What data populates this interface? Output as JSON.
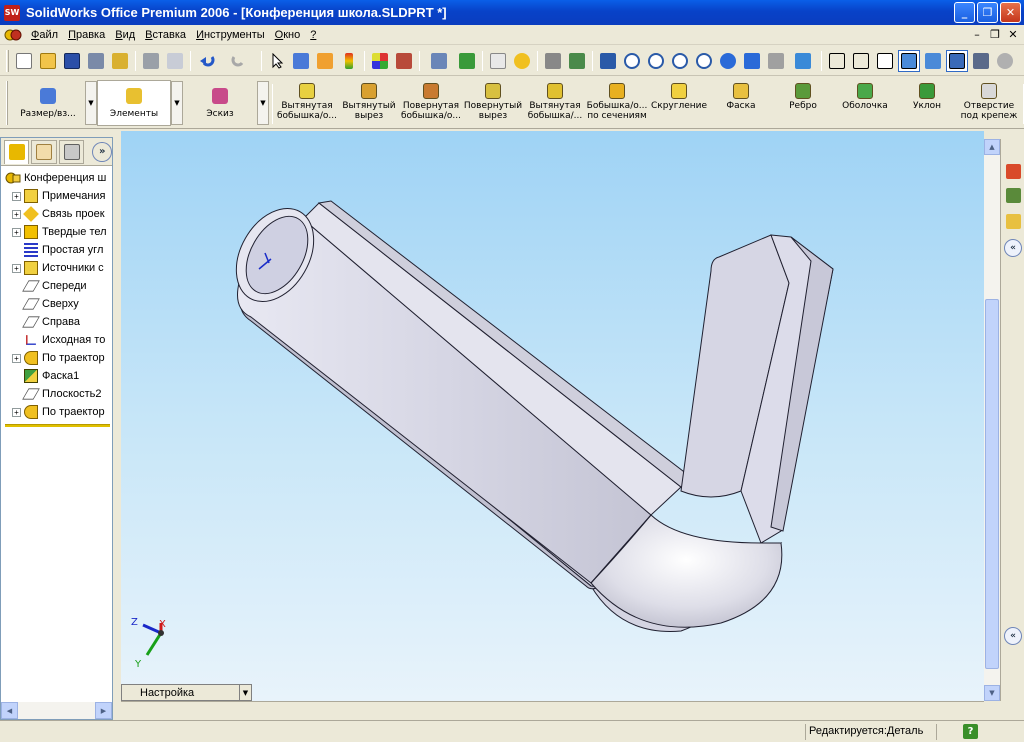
{
  "window": {
    "title": "SolidWorks Office Premium 2006 - [Конференция школа.SLDPRT *]",
    "logo_text": "SW"
  },
  "menu": {
    "items": [
      {
        "u": "Ф",
        "rest": "айл"
      },
      {
        "u": "П",
        "rest": "равка"
      },
      {
        "u": "В",
        "rest": "ид"
      },
      {
        "u": "В",
        "rest": "ставка"
      },
      {
        "u": "И",
        "rest": "нструменты"
      },
      {
        "u": "О",
        "rest": "кно"
      },
      {
        "u": "?",
        "rest": ""
      }
    ]
  },
  "command_manager": {
    "tabs": [
      {
        "label": "Размер/вз...",
        "icon": "dimension-icon"
      },
      {
        "label": "Элементы",
        "icon": "features-icon",
        "active": true
      },
      {
        "label": "Эскиз",
        "icon": "sketch-icon"
      }
    ],
    "commands": [
      {
        "line1": "Вытянутая",
        "line2": "бобышка/о...",
        "icon": "extruded-boss-icon"
      },
      {
        "line1": "Вытянутый",
        "line2": "вырез",
        "icon": "extruded-cut-icon"
      },
      {
        "line1": "Повернутая",
        "line2": "бобышка/о...",
        "icon": "revolved-boss-icon"
      },
      {
        "line1": "Повернутый",
        "line2": "вырез",
        "icon": "revolved-cut-icon"
      },
      {
        "line1": "Вытянутая",
        "line2": "бобышка/...",
        "icon": "swept-boss-icon"
      },
      {
        "line1": "Бобышка/о...",
        "line2": "по сечениям",
        "icon": "loft-icon"
      },
      {
        "line1": "Скругление",
        "line2": "",
        "icon": "fillet-icon"
      },
      {
        "line1": "Фаска",
        "line2": "",
        "icon": "chamfer-icon"
      },
      {
        "line1": "Ребро",
        "line2": "",
        "icon": "rib-icon"
      },
      {
        "line1": "Оболочка",
        "line2": "",
        "icon": "shell-icon"
      },
      {
        "line1": "Уклон",
        "line2": "",
        "icon": "draft-icon"
      },
      {
        "line1": "Отверстие",
        "line2": "под крепеж",
        "icon": "hole-wizard-icon"
      }
    ]
  },
  "feature_tree": {
    "root": "Конференция ш",
    "items": [
      {
        "label": "Примечания",
        "expand": true,
        "icon": "annotations-icon"
      },
      {
        "label": "Связь проек",
        "expand": true,
        "icon": "design-binder-icon"
      },
      {
        "label": "Твердые тел",
        "expand": true,
        "icon": "solid-bodies-icon"
      },
      {
        "label": "Простая угл",
        "expand": false,
        "icon": "material-icon"
      },
      {
        "label": "Источники с",
        "expand": true,
        "icon": "lights-icon"
      },
      {
        "label": "Спереди",
        "expand": false,
        "icon": "plane-icon"
      },
      {
        "label": "Сверху",
        "expand": false,
        "icon": "plane-icon"
      },
      {
        "label": "Справа",
        "expand": false,
        "icon": "plane-icon"
      },
      {
        "label": "Исходная то",
        "expand": false,
        "icon": "origin-icon"
      },
      {
        "label": "По траектор",
        "expand": true,
        "icon": "sweep-feature-icon"
      },
      {
        "label": "Фаска1",
        "expand": false,
        "icon": "chamfer-feature-icon"
      },
      {
        "label": "Плоскость2",
        "expand": false,
        "icon": "plane-icon"
      },
      {
        "label": "По траектор",
        "expand": true,
        "icon": "sweep-feature-icon"
      }
    ]
  },
  "configuration": {
    "label": "Настройка"
  },
  "triad": {
    "x": "X",
    "y": "Y",
    "z": "Z"
  },
  "status": {
    "text": "Редактируется:Деталь",
    "help": "?"
  },
  "colors": {
    "titlebar": "#0a5fe8",
    "viewport_top": "#9fd3f5",
    "part": "#d8d8e6"
  }
}
